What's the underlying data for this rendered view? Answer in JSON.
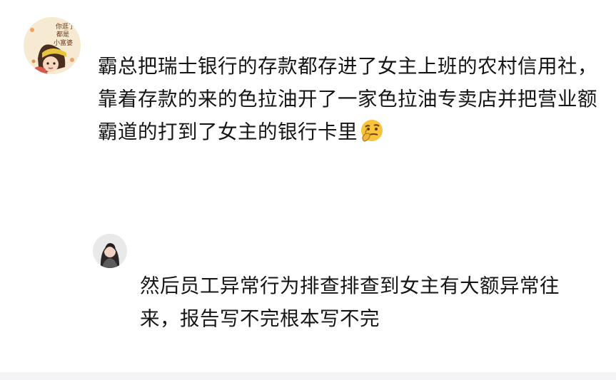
{
  "comments": [
    {
      "text_before_emoji": "霸总把瑞士银行的存款都存进了女主上班的农村信用社，靠着存款的来的色拉油开了一家色拉油专卖店并把营业额霸道的打到了女主的银行卡里",
      "emoji_icon": "thinking-face-emoji"
    },
    {
      "text": "然后员工异常行为排查排查到女主有大额异常往来，报告写不完根本写不完"
    }
  ],
  "avatar_1_text": "你逛了都是小富婆",
  "colors": {
    "text": "#151515",
    "background": "#ffffff",
    "avatar_1_bg": "#f6ead3",
    "avatar_2_bg": "#e9e9ea",
    "bottom_bar": "#f4f4f6"
  }
}
